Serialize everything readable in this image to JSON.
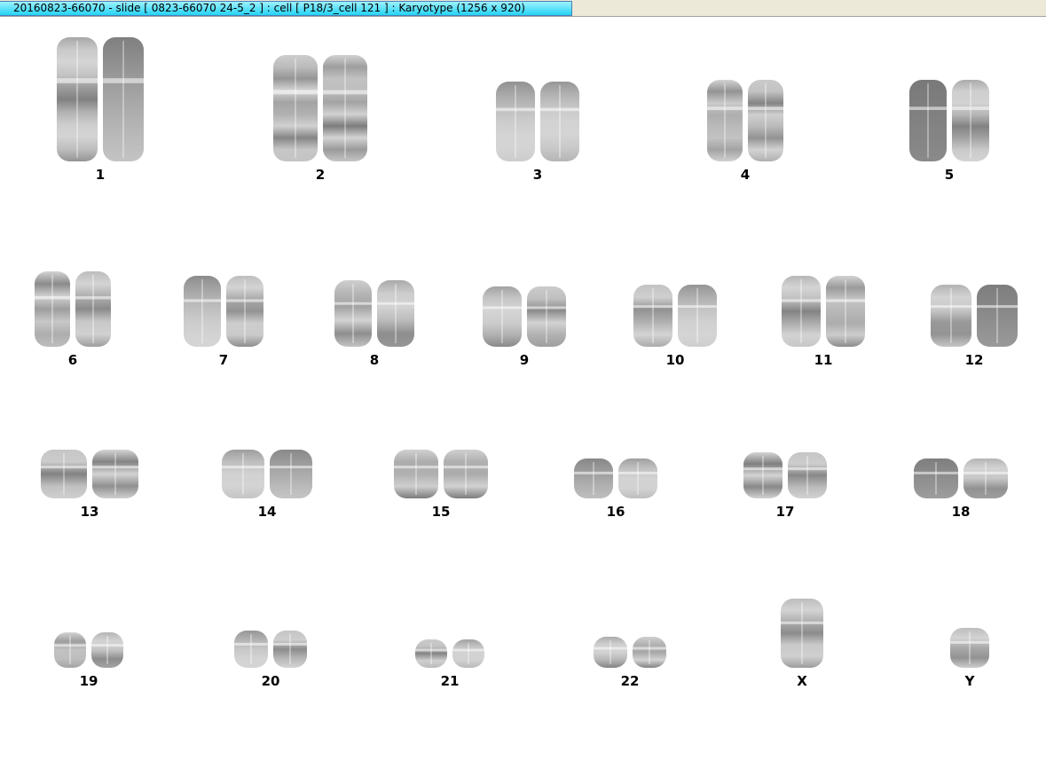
{
  "window": {
    "title": "20160823-66070 - slide [ 0823-66070 24-5_2 ] : cell [ P18/3_cell 121 ] : Karyotype  (1256 x 920)"
  },
  "karyotype": {
    "chromosomes": [
      {
        "label": "1"
      },
      {
        "label": "2"
      },
      {
        "label": "3"
      },
      {
        "label": "4"
      },
      {
        "label": "5"
      },
      {
        "label": "6"
      },
      {
        "label": "7"
      },
      {
        "label": "8"
      },
      {
        "label": "9"
      },
      {
        "label": "10"
      },
      {
        "label": "11"
      },
      {
        "label": "12"
      },
      {
        "label": "13"
      },
      {
        "label": "14"
      },
      {
        "label": "15"
      },
      {
        "label": "16"
      },
      {
        "label": "17"
      },
      {
        "label": "18"
      },
      {
        "label": "19"
      },
      {
        "label": "20"
      },
      {
        "label": "21"
      },
      {
        "label": "22"
      },
      {
        "label": "X"
      },
      {
        "label": "Y"
      }
    ]
  }
}
